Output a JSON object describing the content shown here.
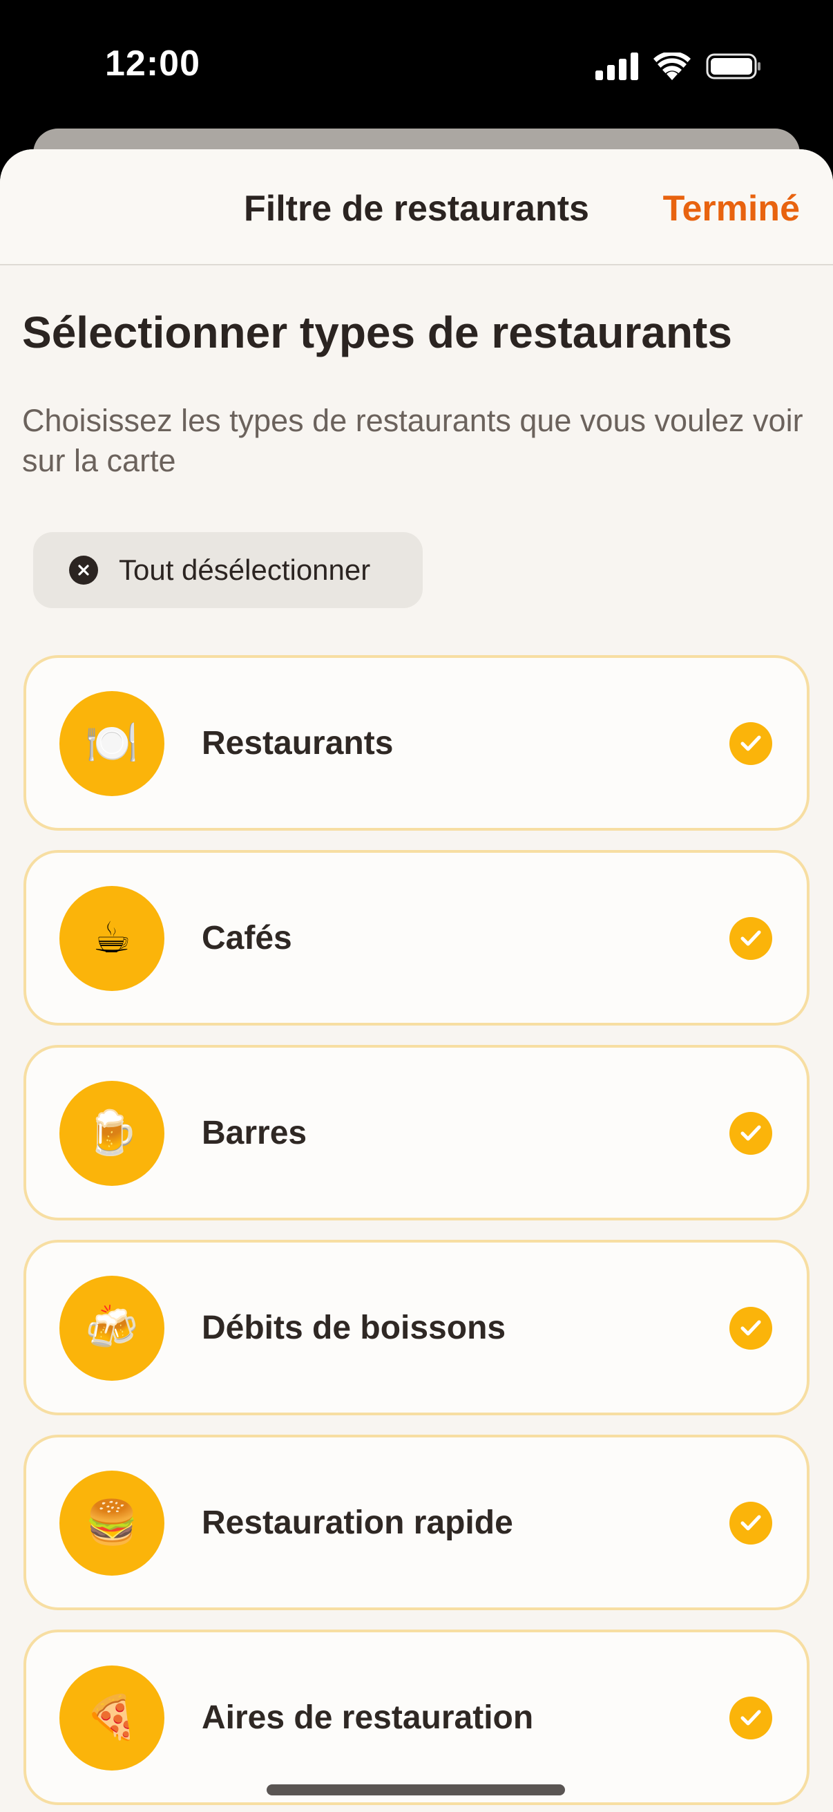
{
  "status_bar": {
    "time": "12:00",
    "icons": [
      "cellular-signal-icon",
      "wifi-icon",
      "battery-icon"
    ]
  },
  "nav": {
    "title": "Filtre de restaurants",
    "done_label": "Terminé",
    "accent_color": "#e8630f"
  },
  "content": {
    "heading": "Sélectionner types de restaurants",
    "subtitle": "Choisissez les types de restaurants que vous voulez voir sur la carte",
    "deselect_all_label": "Tout désélectionner"
  },
  "types": [
    {
      "label": "Restaurants",
      "emoji": "🍽️",
      "icon": "plate-cutlery-icon",
      "selected": true
    },
    {
      "label": "Cafés",
      "emoji": "☕",
      "icon": "coffee-icon",
      "selected": true
    },
    {
      "label": "Barres",
      "emoji": "🍺",
      "icon": "beer-mug-icon",
      "selected": true
    },
    {
      "label": "Débits de boissons",
      "emoji": "🍻",
      "icon": "clinking-beers-icon",
      "selected": true
    },
    {
      "label": "Restauration rapide",
      "emoji": "🍔",
      "icon": "burger-icon",
      "selected": true
    },
    {
      "label": "Aires de restauration",
      "emoji": "🍕",
      "icon": "pizza-icon",
      "selected": true
    }
  ],
  "colors": {
    "brand_yellow": "#fbb40a",
    "card_border": "#f7dea2",
    "text_primary": "#2b2421"
  }
}
